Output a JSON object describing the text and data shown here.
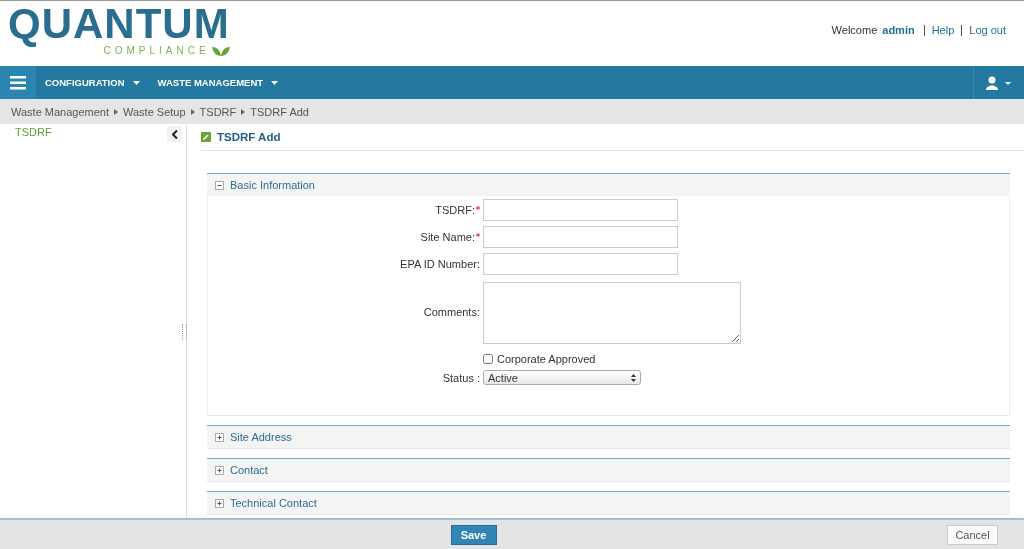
{
  "logo": {
    "title": "QUANTUM",
    "subtitle": "COMPLIANCE"
  },
  "user_bar": {
    "welcome": "Welcome",
    "name": "admin",
    "links": [
      "Help",
      "Log out"
    ]
  },
  "nav": {
    "items": [
      {
        "label": "CONFIGURATION"
      },
      {
        "label": "WASTE MANAGEMENT"
      }
    ]
  },
  "breadcrumb": [
    "Waste Management",
    "Waste Setup",
    "TSDRF",
    "TSDRF Add"
  ],
  "sidebar": {
    "items": [
      {
        "label": "TSDRF",
        "selected": true
      }
    ]
  },
  "page_title": "TSDRF Add",
  "sections": [
    {
      "title": "Basic Information",
      "expanded": true,
      "fields": [
        {
          "kind": "text",
          "label": "TSDRF:",
          "required": true
        },
        {
          "kind": "text",
          "label": "Site Name:",
          "required": true
        },
        {
          "kind": "text",
          "label": "EPA ID Number:",
          "required": false
        },
        {
          "kind": "textarea",
          "label": "Comments:",
          "required": false
        },
        {
          "kind": "checkbox",
          "label": "Corporate Approved",
          "checked": false
        },
        {
          "kind": "select",
          "label": "Status :",
          "value": "Active"
        }
      ]
    },
    {
      "title": "Site Address",
      "expanded": false
    },
    {
      "title": "Contact",
      "expanded": false
    },
    {
      "title": "Technical Contact",
      "expanded": false
    }
  ],
  "footer": {
    "save": "Save",
    "cancel": "Cancel"
  }
}
